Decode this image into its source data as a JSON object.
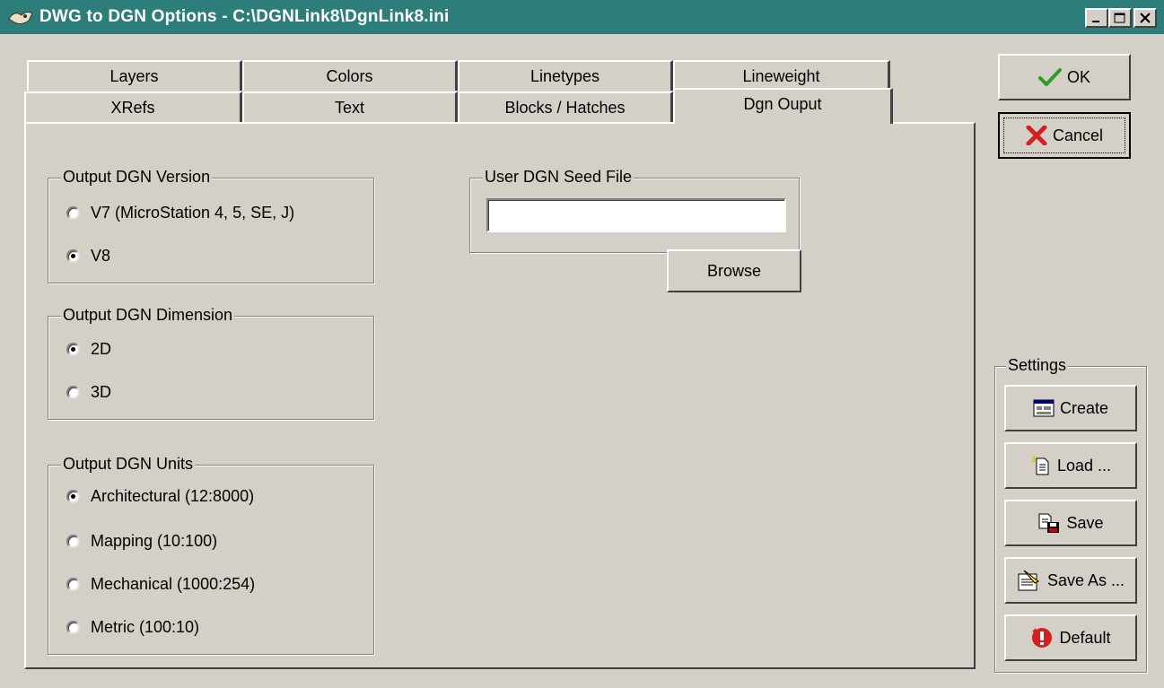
{
  "window": {
    "title": "DWG to DGN Options - C:\\DGNLink8\\DgnLink8.ini",
    "controls": {
      "minimize": "minimize",
      "maximize": "maximize",
      "close": "close"
    }
  },
  "tabs": {
    "row1": [
      "Layers",
      "Colors",
      "Linetypes",
      "Lineweight"
    ],
    "row2": [
      "XRefs",
      "Text",
      "Blocks / Hatches",
      "Dgn Ouput"
    ],
    "active": "Dgn Ouput"
  },
  "output_version": {
    "title": "Output DGN Version",
    "options": [
      {
        "label": "V7 (MicroStation 4, 5, SE, J)",
        "checked": false
      },
      {
        "label": "V8",
        "checked": true
      }
    ]
  },
  "output_dimension": {
    "title": "Output DGN Dimension",
    "options": [
      {
        "label": "2D",
        "checked": true
      },
      {
        "label": "3D",
        "checked": false
      }
    ]
  },
  "output_units": {
    "title": "Output DGN Units",
    "options": [
      {
        "label": "Architectural (12:8000)",
        "checked": true
      },
      {
        "label": "Mapping (10:100)",
        "checked": false
      },
      {
        "label": "Mechanical (1000:254)",
        "checked": false
      },
      {
        "label": "Metric (100:10)",
        "checked": false
      }
    ]
  },
  "seed_file": {
    "title": "User DGN Seed File",
    "value": "",
    "browse_label": "Browse"
  },
  "buttons": {
    "ok": "OK",
    "cancel": "Cancel"
  },
  "settings": {
    "title": "Settings",
    "create": "Create",
    "load": "Load ...",
    "save": "Save",
    "save_as": "Save As ...",
    "default": "Default"
  },
  "icons": {
    "app": "dwg-dgn-app-icon",
    "ok": "checkmark-icon",
    "cancel": "red-x-icon",
    "create": "window-form-icon",
    "load": "document-open-icon",
    "save": "document-save-icon",
    "save_as": "document-save-as-icon",
    "default": "red-restore-icon"
  },
  "colors": {
    "titlebar": "#2d7e7b",
    "face": "#d4d0c8",
    "ok_check": "#2a9d2a",
    "cancel_x": "#d32020"
  }
}
